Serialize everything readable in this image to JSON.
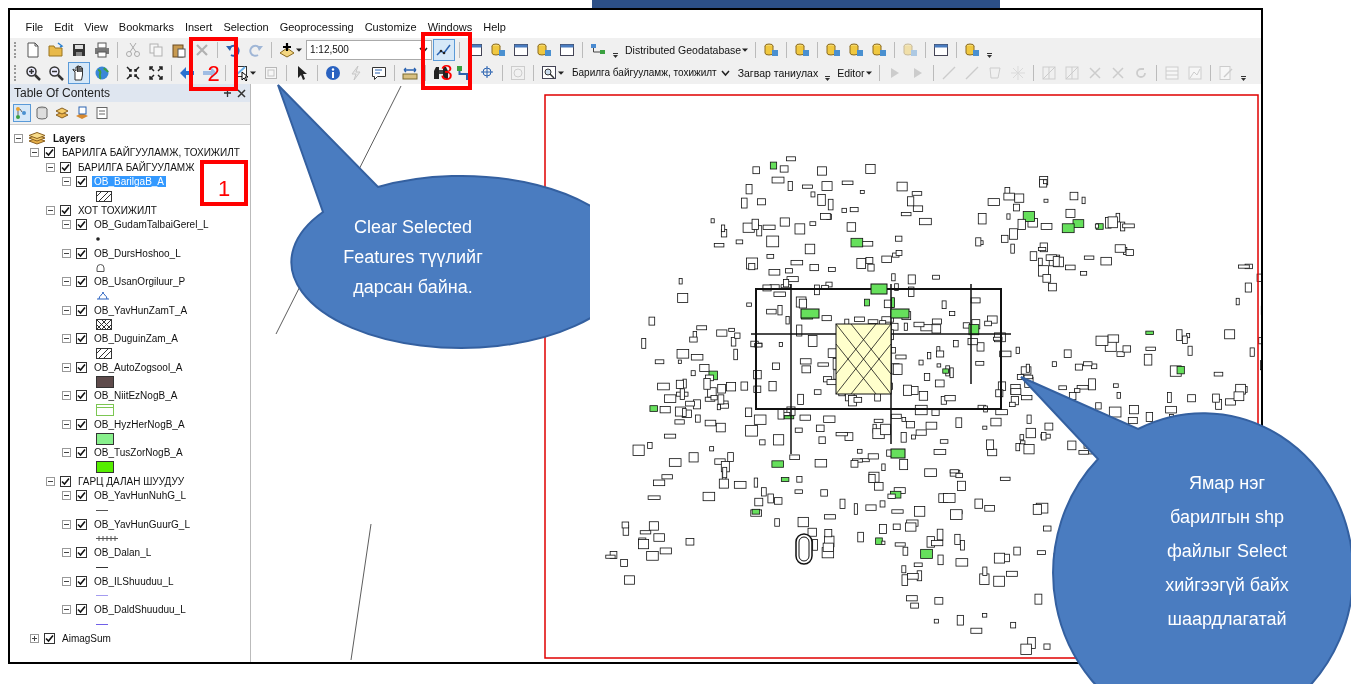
{
  "menu": [
    {
      "label": "File"
    },
    {
      "label": "Edit"
    },
    {
      "label": "View"
    },
    {
      "label": "Bookmarks"
    },
    {
      "label": "Insert"
    },
    {
      "label": "Selection"
    },
    {
      "label": "Geoprocessing"
    },
    {
      "label": "Customize"
    },
    {
      "label": "Windows"
    },
    {
      "label": "Help"
    }
  ],
  "toolbar_1": [
    {
      "kind": "button",
      "disabled": false,
      "active": false
    },
    {
      "kind": "button",
      "disabled": false,
      "active": false
    },
    {
      "kind": "button",
      "disabled": false,
      "active": false
    },
    {
      "kind": "button",
      "disabled": false,
      "active": false
    },
    {
      "kind": "separator"
    },
    {
      "kind": "button",
      "disabled": true,
      "active": false
    },
    {
      "kind": "button",
      "disabled": true,
      "active": false
    },
    {
      "kind": "button",
      "disabled": false,
      "active": false
    },
    {
      "kind": "button",
      "disabled": true,
      "active": false
    },
    {
      "kind": "separator"
    },
    {
      "kind": "button",
      "disabled": false,
      "active": false
    },
    {
      "kind": "button",
      "disabled": true,
      "active": false
    },
    {
      "kind": "separator"
    },
    {
      "kind": "button",
      "disabled": false,
      "active": false
    },
    {
      "kind": "combo",
      "value": "1:12,500"
    },
    {
      "kind": "button",
      "disabled": false,
      "active": true
    },
    {
      "kind": "separator"
    },
    {
      "kind": "button",
      "disabled": false,
      "active": false
    },
    {
      "kind": "button",
      "disabled": false,
      "active": false
    },
    {
      "kind": "button",
      "disabled": false,
      "active": false
    },
    {
      "kind": "button",
      "disabled": false,
      "active": false
    },
    {
      "kind": "button",
      "disabled": false,
      "active": false
    },
    {
      "kind": "separator"
    },
    {
      "kind": "button",
      "disabled": false,
      "active": false
    },
    {
      "kind": "grip"
    },
    {
      "kind": "menu",
      "label": "Distributed Geodatabase"
    },
    {
      "kind": "separator"
    },
    {
      "kind": "button",
      "disabled": false,
      "active": false
    },
    {
      "kind": "separator"
    },
    {
      "kind": "button",
      "disabled": false,
      "active": false
    },
    {
      "kind": "separator"
    },
    {
      "kind": "button",
      "disabled": false,
      "active": false
    },
    {
      "kind": "button",
      "disabled": false,
      "active": false
    },
    {
      "kind": "button",
      "disabled": false,
      "active": false
    },
    {
      "kind": "separator"
    },
    {
      "kind": "button",
      "disabled": true,
      "active": false
    },
    {
      "kind": "separator"
    },
    {
      "kind": "button",
      "disabled": false,
      "active": false
    },
    {
      "kind": "separator"
    },
    {
      "kind": "button",
      "disabled": false,
      "active": false
    },
    {
      "kind": "grip"
    }
  ],
  "toolbar_2": [
    {
      "kind": "button",
      "disabled": false,
      "active": false
    },
    {
      "kind": "button",
      "disabled": false,
      "active": false
    },
    {
      "kind": "button",
      "disabled": false,
      "active": true
    },
    {
      "kind": "button",
      "disabled": false,
      "active": false
    },
    {
      "kind": "separator"
    },
    {
      "kind": "button",
      "disabled": false,
      "active": false
    },
    {
      "kind": "button",
      "disabled": false,
      "active": false
    },
    {
      "kind": "separator"
    },
    {
      "kind": "button",
      "disabled": false,
      "active": false
    },
    {
      "kind": "button",
      "disabled": true,
      "active": false
    },
    {
      "kind": "separator"
    },
    {
      "kind": "button",
      "disabled": false,
      "active": false
    },
    {
      "kind": "button",
      "disabled": true,
      "active": false
    },
    {
      "kind": "separator"
    },
    {
      "kind": "button",
      "disabled": false,
      "active": false
    },
    {
      "kind": "separator"
    },
    {
      "kind": "button",
      "disabled": false,
      "active": false
    },
    {
      "kind": "button",
      "disabled": true,
      "active": false
    },
    {
      "kind": "button",
      "disabled": false,
      "active": false
    },
    {
      "kind": "separator"
    },
    {
      "kind": "button",
      "disabled": false,
      "active": false
    },
    {
      "kind": "separator"
    },
    {
      "kind": "button",
      "disabled": false,
      "active": false
    },
    {
      "kind": "button",
      "disabled": false,
      "active": false
    },
    {
      "kind": "button",
      "disabled": false,
      "active": false
    },
    {
      "kind": "separator"
    },
    {
      "kind": "button",
      "disabled": true,
      "active": false
    },
    {
      "kind": "separator"
    },
    {
      "kind": "button",
      "disabled": false,
      "active": false
    },
    {
      "kind": "combo",
      "value": "Барилга байгууламж, тохижилт"
    },
    {
      "kind": "label",
      "label": "Загвар таниулах"
    },
    {
      "kind": "grip"
    },
    {
      "kind": "menu",
      "label": "Editor"
    },
    {
      "kind": "separator"
    },
    {
      "kind": "button",
      "disabled": true,
      "active": false
    },
    {
      "kind": "button",
      "disabled": true,
      "active": false
    },
    {
      "kind": "separator"
    },
    {
      "kind": "button",
      "disabled": true,
      "active": false
    },
    {
      "kind": "button",
      "disabled": true,
      "active": false
    },
    {
      "kind": "button",
      "disabled": true,
      "active": false
    },
    {
      "kind": "button",
      "disabled": true,
      "active": false
    },
    {
      "kind": "separator"
    },
    {
      "kind": "button",
      "disabled": true,
      "active": false
    },
    {
      "kind": "button",
      "disabled": true,
      "active": false
    },
    {
      "kind": "button",
      "disabled": true,
      "active": false
    },
    {
      "kind": "button",
      "disabled": true,
      "active": false
    },
    {
      "kind": "button",
      "disabled": true,
      "active": false
    },
    {
      "kind": "separator"
    },
    {
      "kind": "button",
      "disabled": true,
      "active": false
    },
    {
      "kind": "button",
      "disabled": true,
      "active": false
    },
    {
      "kind": "separator"
    },
    {
      "kind": "button",
      "disabled": true,
      "active": false
    },
    {
      "kind": "grip"
    }
  ],
  "table_of_contents": {
    "title": "Table Of Contents",
    "tabs": [
      {
        "selected": true
      },
      {
        "selected": false
      },
      {
        "selected": false
      },
      {
        "selected": false
      },
      {
        "selected": false
      }
    ],
    "tree": [
      {
        "kind": "frame",
        "label": "Layers",
        "expanded": true,
        "children": [
          {
            "kind": "group",
            "label": "БАРИЛГА БАЙГУУЛАМЖ, ТОХИЖИЛТ",
            "expanded": true,
            "checked": true,
            "children": [
              {
                "kind": "group",
                "label": "БАРИЛГА БАЙГУУЛАМЖ",
                "expanded": true,
                "checked": true,
                "children": [
                  {
                    "kind": "layer",
                    "label": "OB_BarilgaB_A",
                    "expanded": true,
                    "checked": true,
                    "selected": true,
                    "symbol": {
                      "kind": "hatch"
                    }
                  }
                ]
              },
              {
                "kind": "group",
                "label": "ХОТ ТОХИЖИЛТ",
                "expanded": true,
                "checked": true,
                "children": [
                  {
                    "kind": "layer",
                    "label": "OB_GudamTalbaiGerel_L",
                    "expanded": true,
                    "checked": true,
                    "selected": false,
                    "symbol": {
                      "kind": "dot"
                    }
                  },
                  {
                    "kind": "layer",
                    "label": "OB_DursHoshoo_L",
                    "expanded": true,
                    "checked": true,
                    "selected": false,
                    "symbol": {
                      "kind": "arch"
                    }
                  },
                  {
                    "kind": "layer",
                    "label": "OB_UsanOrgiluur_P",
                    "expanded": true,
                    "checked": true,
                    "selected": false,
                    "symbol": {
                      "kind": "fountain"
                    }
                  },
                  {
                    "kind": "layer",
                    "label": "OB_YavHunZamT_A",
                    "expanded": true,
                    "checked": true,
                    "selected": false,
                    "symbol": {
                      "kind": "crosshatch"
                    }
                  },
                  {
                    "kind": "layer",
                    "label": "OB_DuguinZam_A",
                    "expanded": true,
                    "checked": true,
                    "selected": false,
                    "symbol": {
                      "kind": "hatch"
                    }
                  },
                  {
                    "kind": "layer",
                    "label": "OB_AutoZogsool_A",
                    "expanded": true,
                    "checked": true,
                    "selected": false,
                    "symbol": {
                      "kind": "fill",
                      "color": "#5e4b4b"
                    }
                  },
                  {
                    "kind": "layer",
                    "label": "OB_NiitEzNogB_A",
                    "expanded": true,
                    "checked": true,
                    "selected": false,
                    "symbol": {
                      "kind": "outline",
                      "color": "#7cc652"
                    }
                  },
                  {
                    "kind": "layer",
                    "label": "OB_HyzHerNogB_A",
                    "expanded": true,
                    "checked": true,
                    "selected": false,
                    "symbol": {
                      "kind": "fill",
                      "color": "#88f08c"
                    }
                  },
                  {
                    "kind": "layer",
                    "label": "OB_TusZorNogB_A",
                    "expanded": true,
                    "checked": true,
                    "selected": false,
                    "symbol": {
                      "kind": "fill",
                      "color": "#55ee00"
                    }
                  }
                ]
              },
              {
                "kind": "group",
                "label": "ГАРЦ ДАЛАН ШУУДУУ",
                "expanded": true,
                "checked": true,
                "children": [
                  {
                    "kind": "layer",
                    "label": "OB_YavHunNuhG_L",
                    "expanded": true,
                    "checked": true,
                    "selected": false,
                    "symbol": {
                      "kind": "line",
                      "color": "#555555"
                    }
                  },
                  {
                    "kind": "layer",
                    "label": "OB_YavHunGuurG_L",
                    "expanded": true,
                    "checked": true,
                    "selected": false,
                    "symbol": {
                      "kind": "rail",
                      "color": "#555555"
                    }
                  },
                  {
                    "kind": "layer",
                    "label": "OB_Dalan_L",
                    "expanded": true,
                    "checked": true,
                    "selected": false,
                    "symbol": {
                      "kind": "line",
                      "color": "#333333"
                    }
                  },
                  {
                    "kind": "layer",
                    "label": "OB_ILShuuduu_L",
                    "expanded": true,
                    "checked": true,
                    "selected": false,
                    "symbol": {
                      "kind": "line",
                      "color": "#a49cf0"
                    }
                  },
                  {
                    "kind": "layer",
                    "label": "OB_DaldShuuduu_L",
                    "expanded": true,
                    "checked": true,
                    "selected": false,
                    "symbol": {
                      "kind": "line",
                      "color": "#7060e8"
                    }
                  }
                ]
              }
            ]
          },
          {
            "kind": "layer",
            "label": "AimagSum",
            "expanded": false,
            "checked": true,
            "selected": false
          }
        ]
      }
    ]
  },
  "callouts": [
    {
      "text": "Clear Selected Features түүлийг дарсан байна."
    },
    {
      "text": "Ямар нэг барилгын shp файлыг Select хийгээгүй байх шаардлагатай"
    }
  ],
  "markers": [
    {
      "label": "1"
    },
    {
      "label": "2"
    },
    {
      "label": "3"
    }
  ]
}
